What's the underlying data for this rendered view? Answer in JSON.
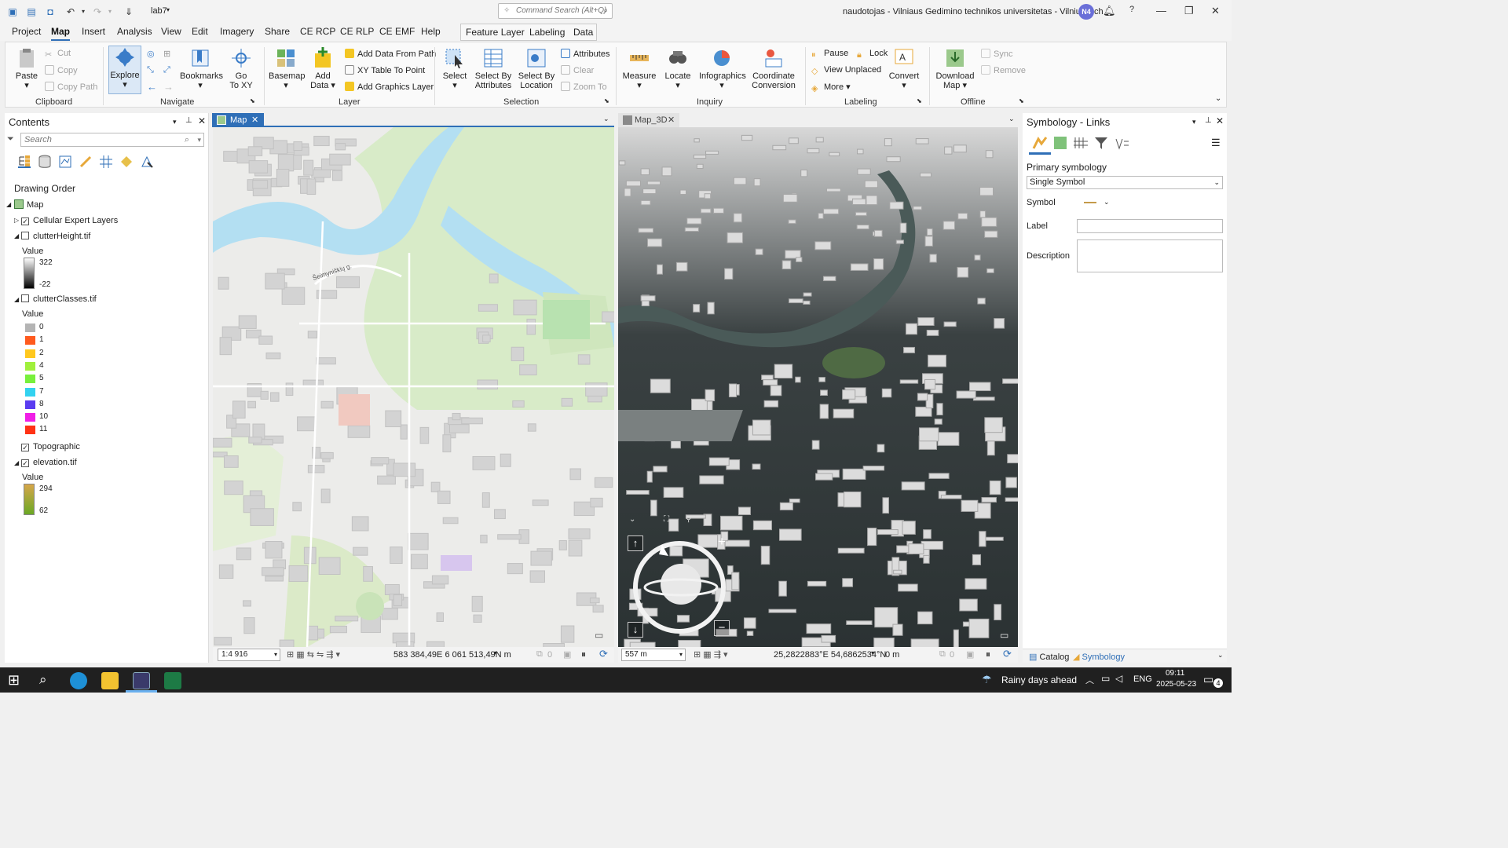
{
  "app": {
    "project_name": "lab7",
    "title_text": "naudotojas - Vilniaus Gedimino technikos universitetas - VilniusTech",
    "user_initials": "N4",
    "command_search_placeholder": "Command Search (Alt+Q)"
  },
  "menu": {
    "tabs": [
      "Project",
      "Map",
      "Insert",
      "Analysis",
      "View",
      "Edit",
      "Imagery",
      "Share",
      "CE RCP",
      "CE RLP",
      "CE EMF",
      "Help"
    ],
    "active_tab": "Map",
    "contextual_tabs": [
      "Feature Layer",
      "Labeling",
      "Data"
    ]
  },
  "ribbon": {
    "clipboard": {
      "paste": "Paste",
      "cut": "Cut",
      "copy": "Copy",
      "copy_path": "Copy Path",
      "group": "Clipboard"
    },
    "navigate": {
      "explore": "Explore",
      "bookmarks": "Bookmarks",
      "go_to_xy_1": "Go",
      "go_to_xy_2": "To XY",
      "group": "Navigate"
    },
    "layer": {
      "basemap": "Basemap",
      "add_data_1": "Add",
      "add_data_2": "Data",
      "add_data_from_path": "Add Data From Path",
      "xy_table_to_point": "XY Table To Point",
      "add_graphics_layer": "Add Graphics Layer",
      "group": "Layer"
    },
    "selection": {
      "select": "Select",
      "select_by_attributes_1": "Select By",
      "select_by_attributes_2": "Attributes",
      "select_by_location_1": "Select By",
      "select_by_location_2": "Location",
      "attributes": "Attributes",
      "clear": "Clear",
      "zoom_to": "Zoom To",
      "group": "Selection"
    },
    "inquiry": {
      "measure": "Measure",
      "locate": "Locate",
      "infographics": "Infographics",
      "coord_conv_1": "Coordinate",
      "coord_conv_2": "Conversion",
      "group": "Inquiry"
    },
    "labeling": {
      "pause": "Pause",
      "lock": "Lock",
      "view_unplaced": "View Unplaced",
      "more": "More",
      "convert": "Convert",
      "group": "Labeling"
    },
    "offline": {
      "download_map_1": "Download",
      "download_map_2": "Map",
      "sync": "Sync",
      "remove": "Remove",
      "group": "Offline"
    }
  },
  "contents": {
    "title": "Contents",
    "search_placeholder": "Search",
    "drawing_order": "Drawing Order",
    "map_name": "Map",
    "layers": [
      {
        "name": "Cellular Expert Layers",
        "checked": true
      },
      {
        "name": "clutterHeight.tif",
        "checked": false,
        "value_label": "Value",
        "max": "322",
        "min": "-22"
      },
      {
        "name": "clutterClasses.tif",
        "checked": false,
        "value_label": "Value"
      },
      {
        "name": "Topographic",
        "checked": true
      },
      {
        "name": "elevation.tif",
        "checked": true,
        "value_label": "Value",
        "max": "294",
        "min": "62"
      }
    ],
    "clutter_classes": [
      {
        "label": "0",
        "color": "#b4b4b4"
      },
      {
        "label": "1",
        "color": "#ff5a1e"
      },
      {
        "label": "2",
        "color": "#ffc81e"
      },
      {
        "label": "4",
        "color": "#a0f03c"
      },
      {
        "label": "5",
        "color": "#78f03c"
      },
      {
        "label": "7",
        "color": "#32d2f0"
      },
      {
        "label": "8",
        "color": "#5a3cf0"
      },
      {
        "label": "10",
        "color": "#f01ee6"
      },
      {
        "label": "11",
        "color": "#ff3214"
      }
    ]
  },
  "views": {
    "tab_2d": "Map",
    "tab_3d": "Map_3D",
    "scale_2d": "1:4 916",
    "coords_2d": "583 384,49E 6 061 513,49N m",
    "selected_2d": "0",
    "scale_3d": "557 m",
    "coords_3d": "25,2822883°E 54,6862534°N",
    "elev_3d": "0 m",
    "selected_3d": "0",
    "street_label": "Šeimyniškių g."
  },
  "symbology": {
    "title": "Symbology - Links",
    "primary": "Primary symbology",
    "mode": "Single Symbol",
    "symbol_label": "Symbol",
    "label_label": "Label",
    "description_label": "Description",
    "tab_catalog": "Catalog",
    "tab_symbology": "Symbology"
  },
  "taskbar": {
    "weather": "Rainy days ahead",
    "lang": "ENG",
    "time": "09:11",
    "date": "2025-05-23",
    "notifications": "4"
  }
}
